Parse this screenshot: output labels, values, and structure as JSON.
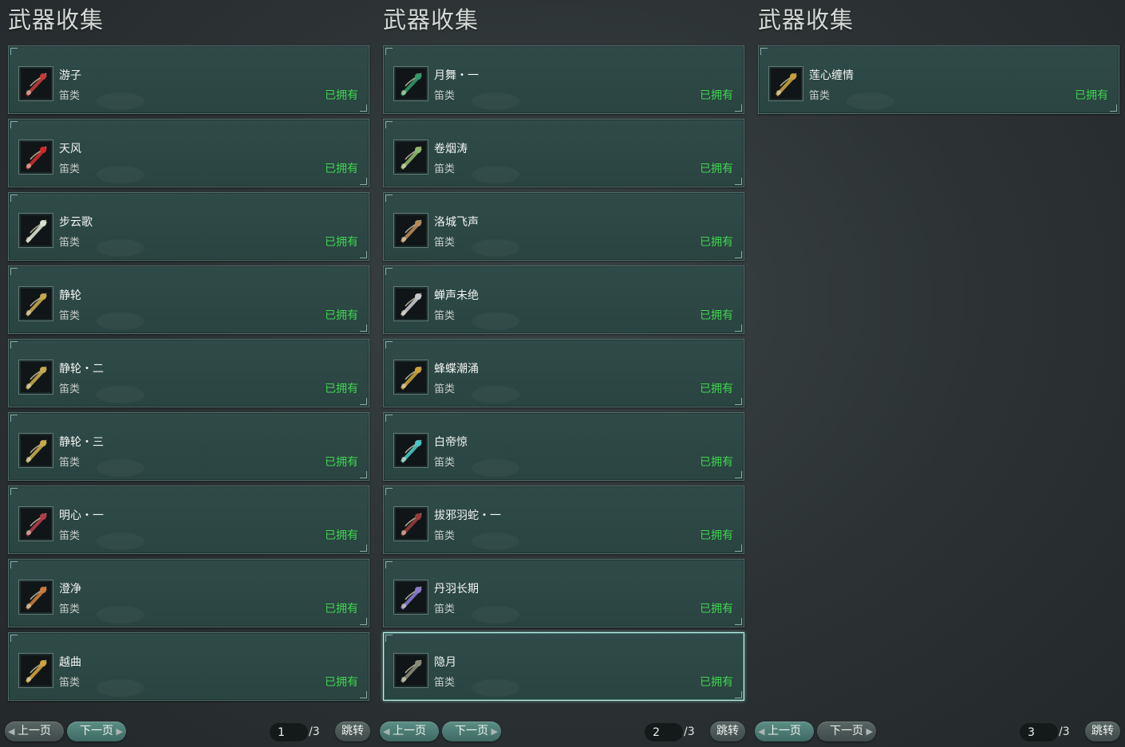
{
  "panels": [
    {
      "title": "武器收集",
      "items": [
        {
          "name": "游子",
          "type": "笛类",
          "status": "已拥有",
          "icon": "flute-red-white-icon",
          "color": "#c33a3a"
        },
        {
          "name": "天风",
          "type": "笛类",
          "status": "已拥有",
          "icon": "flute-red-blue-icon",
          "color": "#d12a2a"
        },
        {
          "name": "步云歌",
          "type": "笛类",
          "status": "已拥有",
          "icon": "flute-white-green-icon",
          "color": "#d8e0d0"
        },
        {
          "name": "静轮",
          "type": "笛类",
          "status": "已拥有",
          "icon": "flute-gold-claw-icon",
          "color": "#c7a84a"
        },
        {
          "name": "静轮・二",
          "type": "笛类",
          "status": "已拥有",
          "icon": "flute-gold-claw-icon",
          "color": "#c7a84a"
        },
        {
          "name": "静轮・三",
          "type": "笛类",
          "status": "已拥有",
          "icon": "flute-gold-claw-icon",
          "color": "#c7a84a"
        },
        {
          "name": "明心・一",
          "type": "笛类",
          "status": "已拥有",
          "icon": "flute-crimson-icon",
          "color": "#b33b4a"
        },
        {
          "name": "澄净",
          "type": "笛类",
          "status": "已拥有",
          "icon": "flute-orange-icon",
          "color": "#c97a3a"
        },
        {
          "name": "越曲",
          "type": "笛类",
          "status": "已拥有",
          "icon": "flute-gold-blade-icon",
          "color": "#d2a23c"
        }
      ],
      "pager": {
        "prev": "上一页",
        "next": "下一页",
        "page": "1",
        "total": "/3",
        "jump": "跳转",
        "active": "next"
      }
    },
    {
      "title": "武器收集",
      "items": [
        {
          "name": "月舞・一",
          "type": "笛类",
          "status": "已拥有",
          "icon": "flute-green-jade-icon",
          "color": "#2f9a6a"
        },
        {
          "name": "卷烟涛",
          "type": "笛类",
          "status": "已拥有",
          "icon": "flute-green-white-icon",
          "color": "#8fb86a"
        },
        {
          "name": "洛城飞声",
          "type": "笛类",
          "status": "已拥有",
          "icon": "flute-tan-red-icon",
          "color": "#b88a5a"
        },
        {
          "name": "蝉声未绝",
          "type": "笛类",
          "status": "已拥有",
          "icon": "flute-silver-icon",
          "color": "#c8c8cc"
        },
        {
          "name": "蜂蝶潮涌",
          "type": "笛类",
          "status": "已拥有",
          "icon": "flute-gold-ruby-icon",
          "color": "#c9a23a"
        },
        {
          "name": "白帝惊",
          "type": "笛类",
          "status": "已拥有",
          "icon": "flute-cyan-purple-icon",
          "color": "#4ac6c8"
        },
        {
          "name": "拔邪羽蛇・一",
          "type": "笛类",
          "status": "已拥有",
          "icon": "flute-dark-red-icon",
          "color": "#9a3a3a"
        },
        {
          "name": "丹羽长期",
          "type": "笛类",
          "status": "已拥有",
          "icon": "flute-violet-icon",
          "color": "#8a7ad0"
        },
        {
          "name": "隐月",
          "type": "笛类",
          "status": "已拥有",
          "icon": "flute-bronze-icon",
          "color": "#8a8a7a"
        }
      ],
      "selected_index": 8,
      "pager": {
        "prev": "上一页",
        "next": "下一页",
        "page": "2",
        "total": "/3",
        "jump": "跳转",
        "active": "both"
      }
    },
    {
      "title": "武器收集",
      "items": [
        {
          "name": "莲心缠情",
          "type": "笛类",
          "status": "已拥有",
          "icon": "flute-gold-ornate-icon",
          "color": "#c8a03a"
        }
      ],
      "pager": {
        "prev": "上一页",
        "next": "下一页",
        "page": "3",
        "total": "/3",
        "jump": "跳转",
        "active": "prev"
      }
    }
  ]
}
